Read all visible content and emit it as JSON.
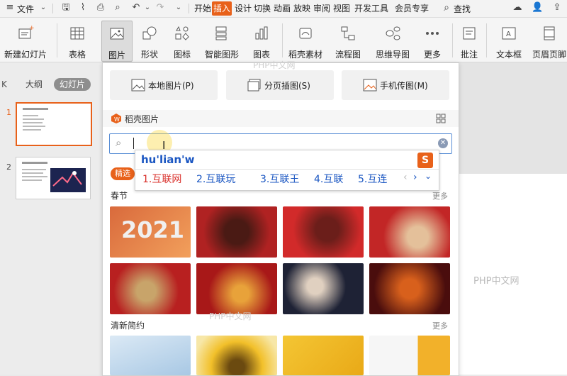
{
  "menubar": {
    "file_label": "文件",
    "tabs": [
      "开始",
      "插入",
      "设计",
      "切换",
      "动画",
      "放映",
      "审阅",
      "视图",
      "开发工具",
      "会员专享"
    ],
    "active_tab": "插入",
    "search_label": "查找"
  },
  "ribbon": {
    "new_slide": "新建幻灯片",
    "table": "表格",
    "picture": "图片",
    "shape": "形状",
    "icon": "图标",
    "smartart": "智能图形",
    "chart": "图表",
    "material": "稻壳素材",
    "flowchart": "流程图",
    "mindmap": "思维导图",
    "more": "更多",
    "comment": "批注",
    "textbox": "文本框",
    "header_footer": "页眉页脚"
  },
  "leftpanel": {
    "tab_outline": "大纲",
    "tab_slides": "幻灯片",
    "slides": [
      {
        "num": "1"
      },
      {
        "num": "2"
      }
    ]
  },
  "panel": {
    "local_picture": "本地图片(P)",
    "page_picture": "分页插图(S)",
    "phone_picture": "手机传图(M)",
    "wave_title": "稻壳图片",
    "search_value": "",
    "tag_featured": "精选",
    "section1": "春节",
    "section2": "清新简约",
    "more_label": "更多"
  },
  "ime": {
    "composition": "hu'lian'w",
    "candidates": [
      "1.互联网",
      "2.互联玩",
      "3.互联王",
      "4.互联",
      "5.互连"
    ]
  },
  "watermarks": [
    "PHP中文网",
    "PHP中文网",
    "PHP中文网"
  ],
  "image_texts": {
    "year_2021": "2021"
  }
}
